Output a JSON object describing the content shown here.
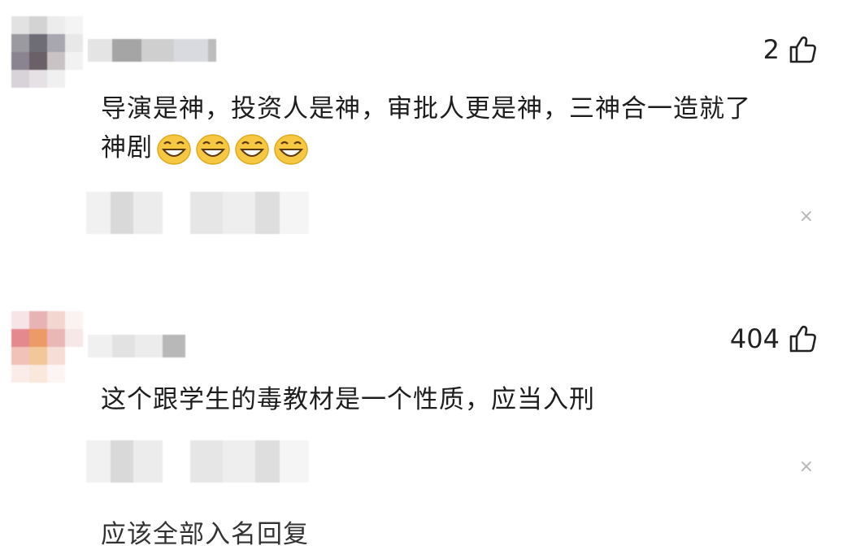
{
  "comments": [
    {
      "likes": "2",
      "text": "导演是神，投资人是神，审批人更是神，三神合一造就了",
      "text_cont": "神剧",
      "emojis": [
        "grin-emoji",
        "grin-emoji",
        "grin-emoji",
        "grin-emoji"
      ]
    },
    {
      "likes": "404",
      "text": "这个跟学生的毒教材是一个性质，应当入刑"
    }
  ],
  "close_glyph": "×",
  "clipped_text": "应该全部入名回复",
  "colors": {
    "like_icon": "#222222",
    "close": "#b5b5b5",
    "emoji_face": "#f6c842"
  }
}
